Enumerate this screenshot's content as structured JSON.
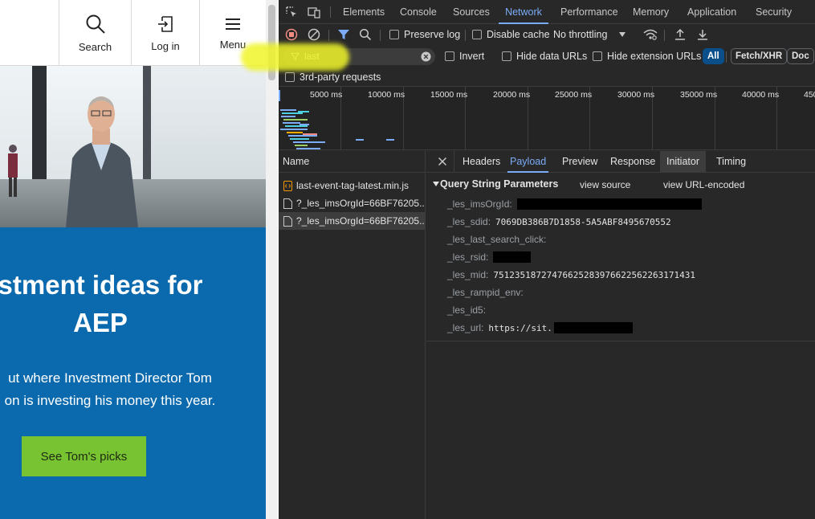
{
  "site": {
    "header": {
      "search_label": "Search",
      "login_label": "Log in",
      "menu_label": "Menu"
    },
    "promo": {
      "title": "stment ideas for\nAEP",
      "text": "ut where Investment Director Tom\non is investing his money this year.",
      "cta_label": "See Tom's picks",
      "accent": "#0b6aad",
      "cta_color": "#78c331"
    }
  },
  "devtools": {
    "tabs": [
      "Elements",
      "Console",
      "Sources",
      "Network",
      "Performance",
      "Memory",
      "Application",
      "Security"
    ],
    "active_tab": "Network",
    "toolbar": {
      "preserve_log": "Preserve log",
      "disable_cache": "Disable cache",
      "throttling": "No throttling"
    },
    "filter": {
      "value": "last",
      "invert": "Invert",
      "hide_data_urls": "Hide data URLs",
      "hide_extension_urls": "Hide extension URLs",
      "type_all": "All",
      "type_fetch": "Fetch/XHR",
      "type_doc": "Doc",
      "third_party": "3rd-party requests"
    },
    "timeline": {
      "ticks": [
        "5000 ms",
        "10000 ms",
        "15000 ms",
        "20000 ms",
        "25000 ms",
        "30000 ms",
        "35000 ms",
        "40000 ms",
        "450"
      ]
    },
    "requests": {
      "header": "Name",
      "rows": [
        {
          "name": "last-event-tag-latest.min.js",
          "type": "script"
        },
        {
          "name": "?_les_imsOrgId=66BF76205...",
          "type": "document"
        },
        {
          "name": "?_les_imsOrgId=66BF76205...",
          "type": "document",
          "selected": true
        }
      ]
    },
    "detail": {
      "tabs": [
        "Headers",
        "Payload",
        "Preview",
        "Response",
        "Initiator",
        "Timing"
      ],
      "active_tab": "Payload",
      "section_title": "Query String Parameters",
      "view_source": "view source",
      "view_encoded": "view URL-encoded",
      "params": [
        {
          "key": "_les_imsOrgId:",
          "value": "",
          "redacted": true
        },
        {
          "key": "_les_sdid:",
          "value": "7069DB386B7D1858-5A5ABF8495670552"
        },
        {
          "key": "_les_last_search_click:",
          "value": ""
        },
        {
          "key": "_les_rsid:",
          "value": "",
          "redacted": true
        },
        {
          "key": "_les_mid:",
          "value": "75123518727476625283976622562263171431"
        },
        {
          "key": "_les_rampid_env:",
          "value": ""
        },
        {
          "key": "_les_id5:",
          "value": ""
        },
        {
          "key": "_les_url:",
          "value": "https://sit.",
          "redacted": true
        }
      ]
    },
    "colors": {
      "active_blue": "#7cacf8",
      "background": "#282828"
    }
  }
}
